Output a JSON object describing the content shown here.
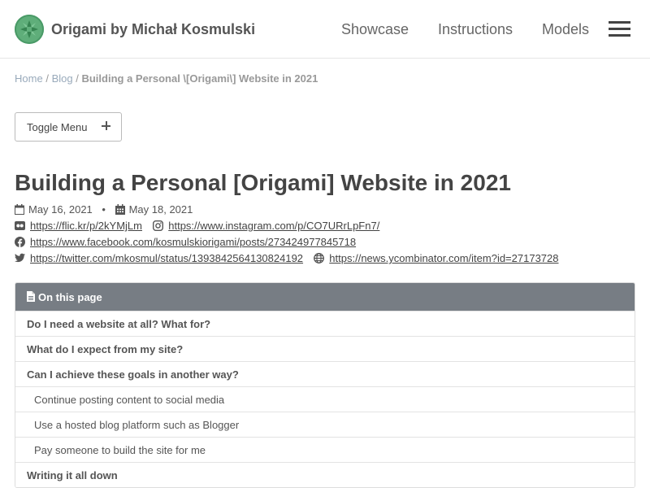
{
  "header": {
    "site_title": "Origami by Michał Kosmulski",
    "nav": [
      "Showcase",
      "Instructions",
      "Models"
    ]
  },
  "breadcrumb": {
    "home": "Home",
    "sep": "/",
    "blog": "Blog",
    "current": "Building a Personal \\[Origami\\] Website in 2021"
  },
  "toggle": {
    "label": "Toggle Menu"
  },
  "article": {
    "title": "Building a Personal [Origami] Website in 2021",
    "published": "May 16, 2021",
    "bullet": "•",
    "updated": "May 18, 2021",
    "links": {
      "flickr": "https://flic.kr/p/2kYMjLm",
      "instagram": "https://www.instagram.com/p/CO7URrLpFn7/",
      "facebook": "https://www.facebook.com/kosmulskiorigami/posts/273424977845718",
      "twitter": "https://twitter.com/mkosmul/status/1393842564130824192",
      "hackernews": "https://news.ycombinator.com/item?id=27173728"
    }
  },
  "toc": {
    "heading": "On this page",
    "items": [
      {
        "label": "Do I need a website at all? What for?",
        "level": 1
      },
      {
        "label": "What do I expect from my site?",
        "level": 1
      },
      {
        "label": "Can I achieve these goals in another way?",
        "level": 1
      },
      {
        "label": "Continue posting content to social media",
        "level": 2
      },
      {
        "label": "Use a hosted blog platform such as Blogger",
        "level": 2
      },
      {
        "label": "Pay someone to build the site for me",
        "level": 2
      },
      {
        "label": "Writing it all down",
        "level": 1
      }
    ]
  },
  "colors": {
    "toc_header": "#777d84",
    "logo": "#5fae7a"
  }
}
